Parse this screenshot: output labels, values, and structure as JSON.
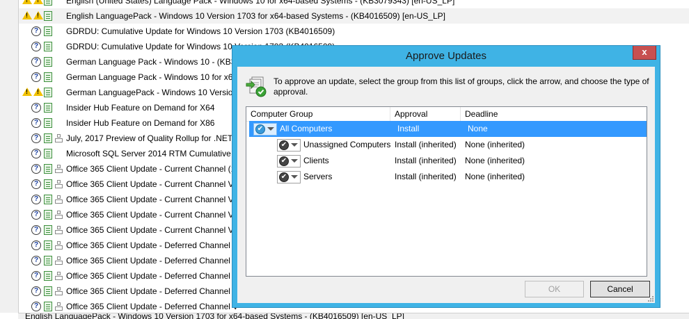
{
  "updates": [
    {
      "icons": [
        "warn",
        "warn",
        "doc"
      ],
      "name": "English (United States) Language Pack - Windows 10 for x64-based Systems - (KB3079343) [en-US_LP]",
      "alt": false
    },
    {
      "icons": [
        "warn",
        "warn",
        "doc"
      ],
      "name": "English LanguagePack - Windows 10 Version 1703 for x64-based Systems - (KB4016509) [en-US_LP]",
      "alt": true
    },
    {
      "icons": [
        "q",
        "doc"
      ],
      "name": "GDRDU: Cumulative Update for Windows 10 Version 1703 (KB4016509)",
      "alt": false
    },
    {
      "icons": [
        "q",
        "doc"
      ],
      "name": "GDRDU: Cumulative Update for Windows 10 Version 1703 (KB4016509)",
      "alt": false
    },
    {
      "icons": [
        "q",
        "doc"
      ],
      "name": "German Language Pack - Windows 10 - (KB3",
      "alt": false
    },
    {
      "icons": [
        "q",
        "doc"
      ],
      "name": "German Language Pack - Windows 10 for x64",
      "alt": false
    },
    {
      "icons": [
        "warn",
        "warn",
        "doc"
      ],
      "name": "German LanguagePack - Windows 10 Version",
      "alt": false
    },
    {
      "icons": [
        "q",
        "doc"
      ],
      "name": "Insider Hub Feature on Demand for X64",
      "alt": false
    },
    {
      "icons": [
        "q",
        "doc"
      ],
      "name": "Insider Hub Feature on Demand for X86",
      "alt": false
    },
    {
      "icons": [
        "q",
        "doc",
        "tree"
      ],
      "name": "July, 2017 Preview of Quality Rollup for .NET F",
      "alt": false
    },
    {
      "icons": [
        "q",
        "doc"
      ],
      "name": "Microsoft SQL Server 2014 RTM Cumulative U",
      "alt": false
    },
    {
      "icons": [
        "q",
        "doc",
        "tree"
      ],
      "name": "Office 365 Client Update - Current Channel (1",
      "alt": false
    },
    {
      "icons": [
        "q",
        "doc",
        "tree"
      ],
      "name": "Office 365 Client Update - Current Channel V",
      "alt": false
    },
    {
      "icons": [
        "q",
        "doc",
        "tree"
      ],
      "name": "Office 365 Client Update - Current Channel V",
      "alt": false
    },
    {
      "icons": [
        "q",
        "doc",
        "tree"
      ],
      "name": "Office 365 Client Update - Current Channel V",
      "alt": false
    },
    {
      "icons": [
        "q",
        "doc",
        "tree"
      ],
      "name": "Office 365 Client Update - Current Channel V",
      "alt": false
    },
    {
      "icons": [
        "q",
        "doc",
        "tree"
      ],
      "name": "Office 365 Client Update - Deferred Channel (",
      "alt": false
    },
    {
      "icons": [
        "q",
        "doc",
        "tree"
      ],
      "name": "Office 365 Client Update - Deferred Channel (",
      "alt": false
    },
    {
      "icons": [
        "q",
        "doc",
        "tree"
      ],
      "name": "Office 365 Client Update - Deferred Channel V",
      "alt": false
    },
    {
      "icons": [
        "q",
        "doc",
        "tree"
      ],
      "name": "Office 365 Client Update - Deferred Channel V",
      "alt": false
    },
    {
      "icons": [
        "q",
        "doc",
        "tree"
      ],
      "name": "Office 365 Client Update - Deferred Channel V",
      "alt": false
    }
  ],
  "status_text": "English LanguagePack - Windows 10 Version 1703 for x64-based Systems - (KB4016509) [en-US_LP]",
  "dialog": {
    "title": "Approve Updates",
    "close_glyph": "x",
    "instruction": "To approve an update, select the group from this list of groups, click the arrow, and choose the type of approval.",
    "columns": {
      "group": "Computer Group",
      "approval": "Approval",
      "deadline": "Deadline"
    },
    "groups": [
      {
        "name": "All Computers",
        "approval": "Install",
        "deadline": "None",
        "selected": true
      },
      {
        "name": "Unassigned Computers",
        "approval": "Install (inherited)",
        "deadline": "None (inherited)",
        "selected": false
      },
      {
        "name": "Clients",
        "approval": "Install (inherited)",
        "deadline": "None (inherited)",
        "selected": false
      },
      {
        "name": "Servers",
        "approval": "Install (inherited)",
        "deadline": "None (inherited)",
        "selected": false
      }
    ],
    "ok_label": "OK",
    "cancel_label": "Cancel"
  },
  "colors": {
    "titlebar": "#3fb3e5",
    "selection": "#3399ff",
    "close": "#c75050",
    "warning": "#f2c200"
  }
}
